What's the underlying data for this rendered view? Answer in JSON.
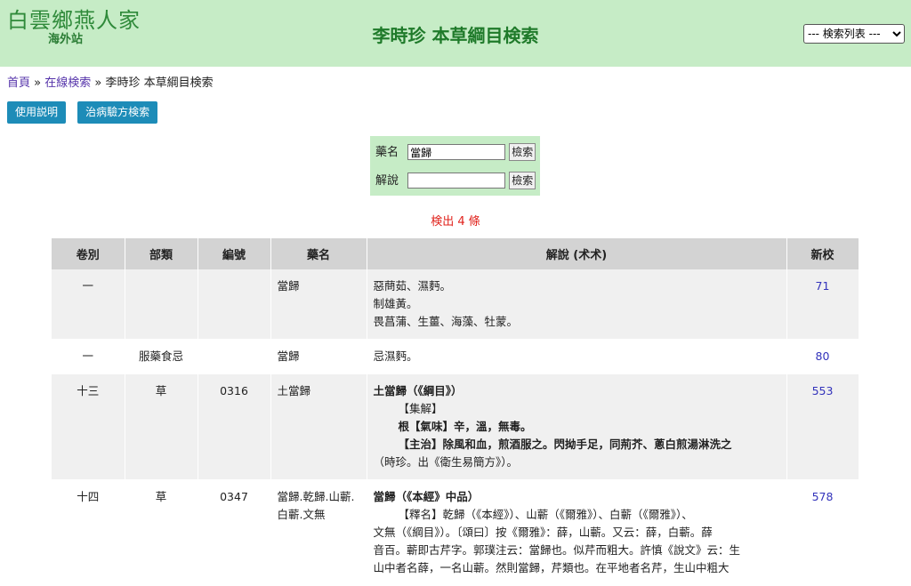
{
  "header": {
    "logo_text": "白雲鄉燕人家",
    "logo_sub": "海外站",
    "title": "李時珍 本草綱目検索",
    "select_value": "--- 検索列表 ---"
  },
  "breadcrumb": {
    "home": "首頁",
    "sep1": "»",
    "online": "在線検索",
    "sep2": "»",
    "current": "李時珍 本草綱目検索"
  },
  "buttons": {
    "help": "使用説明",
    "recipe": "治病驗方検索"
  },
  "search": {
    "name_label": "藥名",
    "name_value": "當歸",
    "name_btn": "檢索",
    "desc_label": "解說",
    "desc_value": "",
    "desc_btn": "檢索"
  },
  "result": "検出 4 條",
  "table": {
    "headers": [
      "卷別",
      "部類",
      "編號",
      "藥名",
      "解說 (术术)",
      "新校"
    ],
    "rows": [
      {
        "vol": "一",
        "cat": "",
        "num": "",
        "name": "當歸",
        "desc": [
          "惡蔄茹、濕麪。",
          "制雄黃。",
          "畏菖蒲、生薑、海藻、牡蒙。"
        ],
        "page": "71"
      },
      {
        "vol": "一",
        "cat": "服藥食忌",
        "num": "",
        "name": "當歸",
        "desc": [
          "忌濕麪。"
        ],
        "page": "80"
      },
      {
        "vol": "十三",
        "cat": "草",
        "num": "0316",
        "name": "土當歸",
        "desc": [
          "土當歸（《綱目》）",
          "【集解】",
          "根【氣味】辛，溫，無毒。",
          "【主治】除風和血，煎酒服之。閃拗手足，同荊芥、蔥白煎湯淋洗之",
          "（時珍。出《衛生易簡方》）。"
        ],
        "page": "553"
      },
      {
        "vol": "十四",
        "cat": "草",
        "num": "0347",
        "name": "當歸.乾歸.山蘄.白蘄.文無",
        "desc": [
          "當歸（《本經》中品）",
          "【釋名】乾歸（《本經》）、山蘄（《爾雅》）、白蘄（《爾雅》）、",
          "文無（《綱目》）。〔頌曰〕按《爾雅》：薛，山蘄。又云：薛，白蘄。薛",
          "音百。蘄即古芹字。郭璞注云：當歸也。似芹而粗大。許慎《說文》云：生",
          "山中者名薛，一名山蘄。然則當歸，芹類也。在平地者名芹，生山中粗大"
        ],
        "page": "578"
      }
    ]
  },
  "colors": {
    "header_bg": "#c6ecc6",
    "title": "#1f7a2a",
    "button_bg": "#1d8cb8",
    "result": "#e0201a",
    "link": "#3333bb"
  }
}
